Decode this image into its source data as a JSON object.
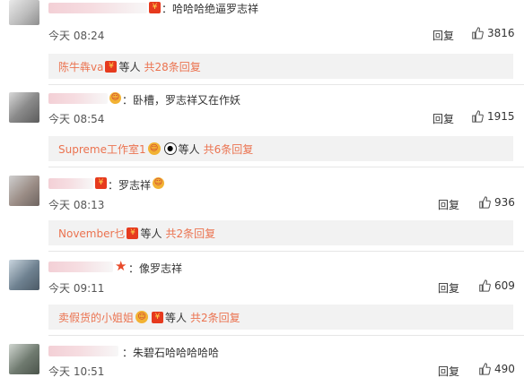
{
  "comments": [
    {
      "text": "哈哈哈绝逼罗志祥",
      "time": "今天 08:24",
      "reply_label": "回复",
      "likes": "3816",
      "sub": {
        "user": "陈牛犇va",
        "middle": "等人",
        "summary": "共28条回复"
      }
    },
    {
      "text": "卧槽，罗志祥又在作妖",
      "time": "今天 08:54",
      "reply_label": "回复",
      "likes": "1915",
      "sub": {
        "user": "Supreme工作室1",
        "middle": "等人",
        "summary": "共6条回复"
      }
    },
    {
      "text": "罗志祥",
      "time": "今天 08:13",
      "reply_label": "回复",
      "likes": "936",
      "sub": {
        "user": "November乜",
        "middle": "等人",
        "summary": "共2条回复"
      }
    },
    {
      "text": "像罗志祥",
      "time": "今天 09:11",
      "reply_label": "回复",
      "likes": "609",
      "sub": {
        "user": "卖假货的小姐姐",
        "middle": "等人",
        "summary": "共2条回复"
      }
    },
    {
      "text": "朱碧石哈哈哈哈哈",
      "time": "今天 10:51",
      "reply_label": "回复",
      "likes": "490"
    }
  ],
  "colon": "：",
  "icons": {
    "like": "thumbs-up-icon",
    "badge": "red-envelope-badge-icon"
  },
  "colors": {
    "link": "#eb7350",
    "subbox": "#f2f2f2"
  }
}
